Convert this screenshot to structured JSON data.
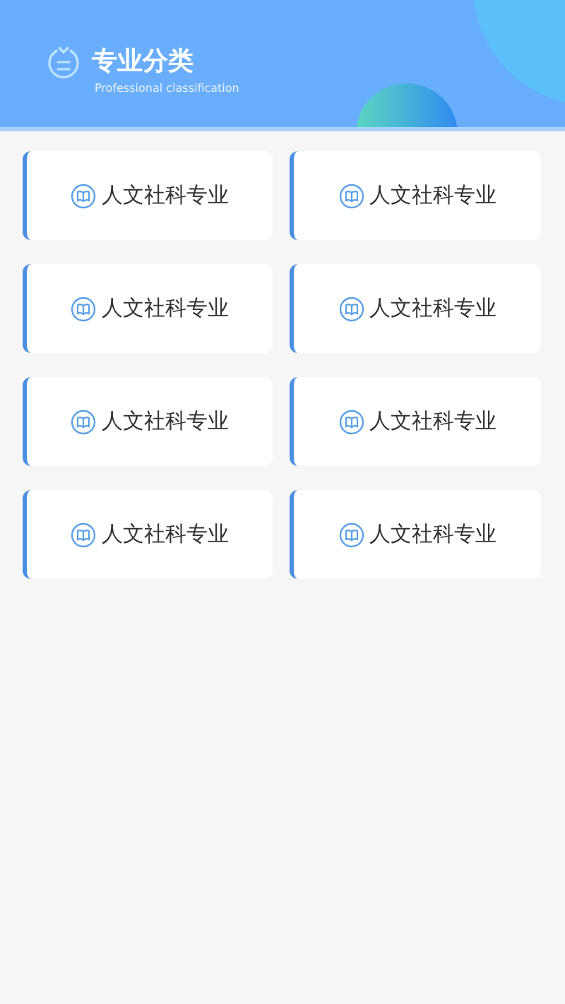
{
  "header": {
    "title": "专业分类",
    "subtitle": "Professional classification"
  },
  "categories": [
    {
      "label": "人文社科专业"
    },
    {
      "label": "人文社科专业"
    },
    {
      "label": "人文社科专业"
    },
    {
      "label": "人文社科专业"
    },
    {
      "label": "人文社科专业"
    },
    {
      "label": "人文社科专业"
    },
    {
      "label": "人文社科专业"
    },
    {
      "label": "人文社科专业"
    }
  ]
}
